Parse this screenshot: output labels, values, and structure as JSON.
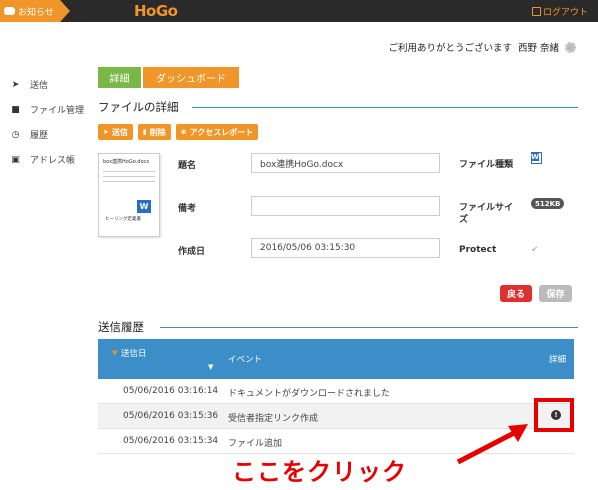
{
  "topbar": {
    "notice_label": "お知らせ",
    "logo": "HoGo",
    "logout_label": "ログアウト"
  },
  "greeting": {
    "message": "ご利用ありがとうございます",
    "user": "西野 奈緒"
  },
  "sidebar": {
    "items": [
      {
        "label": "送信",
        "icon": "send-icon"
      },
      {
        "label": "ファイル管理",
        "icon": "folder-icon"
      },
      {
        "label": "履歴",
        "icon": "clock-icon"
      },
      {
        "label": "アドレス帳",
        "icon": "addressbook-icon"
      }
    ]
  },
  "tabs": {
    "detail": "詳細",
    "dashboard": "ダッシュボード"
  },
  "file_detail": {
    "title": "ファイルの詳細",
    "actions": {
      "send": "送信",
      "delete": "削除",
      "access_report": "アクセスレポート"
    },
    "thumbnail": {
      "title": "box連携HoGo.docx",
      "footer": "ヒーリング定義書"
    },
    "fields": {
      "name_label": "題名",
      "name_value": "box連携HoGo.docx",
      "note_label": "備考",
      "note_value": "",
      "created_label": "作成日",
      "created_value": "2016/05/06 03:15:30"
    },
    "right": {
      "filetype_label": "ファイル種類",
      "filesize_label": "ファイルサイズ",
      "filesize_value": "512KB",
      "protect_label": "Protect"
    },
    "buttons": {
      "back": "戻る",
      "save": "保存"
    }
  },
  "history": {
    "title": "送信履歴",
    "columns": {
      "date": "送信日",
      "event": "イベント",
      "detail": "詳細"
    },
    "rows": [
      {
        "date": "05/06/2016 03:16:14",
        "event": "ドキュメントがダウンロードされました"
      },
      {
        "date": "05/06/2016 03:15:36",
        "event": "受信者指定リンク作成"
      },
      {
        "date": "05/06/2016 03:15:34",
        "event": "ファイル追加"
      }
    ]
  },
  "annotation": {
    "callout": "ここをクリック",
    "color": "#e60000"
  },
  "colors": {
    "accent_orange": "#f09628",
    "accent_green": "#7ab648",
    "table_header": "#3b8ec7",
    "topbar": "#2a2a2a"
  }
}
